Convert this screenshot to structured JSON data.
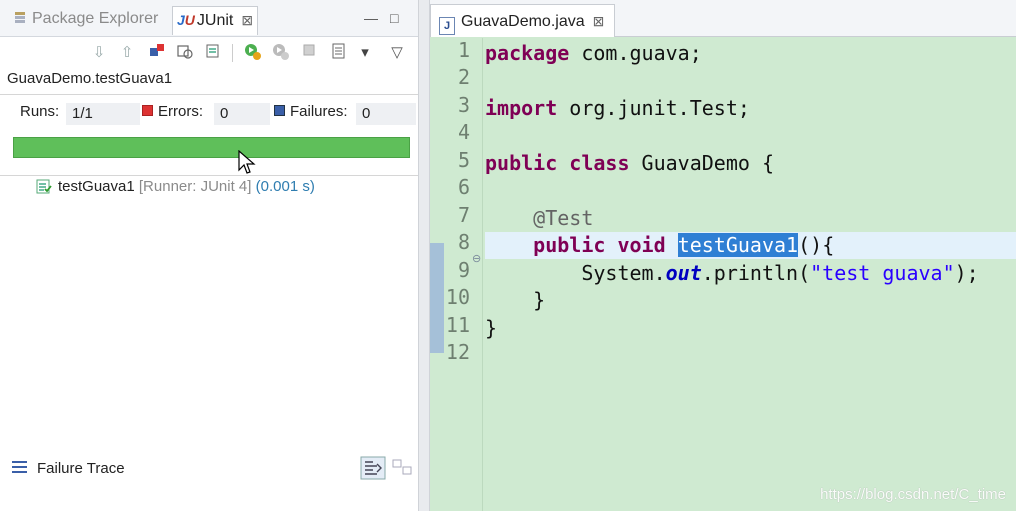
{
  "left_tabs": {
    "package_explorer": "Package Explorer",
    "junit": "JUnit",
    "junit_close": "⊠",
    "minimize": "—",
    "maximize": "□"
  },
  "junit": {
    "test_label": "GuavaDemo.testGuava1",
    "runs_label": "Runs:",
    "runs_value": "1/1",
    "errors_label": "Errors:",
    "errors_value": "0",
    "failures_label": "Failures:",
    "failures_value": "0",
    "progress": 1.0,
    "progress_color": "#5fbf5a",
    "tree": {
      "name": "testGuava1",
      "runner": "[Runner: JUnit 4]",
      "time": "(0.001 s)"
    },
    "failure_trace_label": "Failure Trace"
  },
  "editor": {
    "tab_label": "GuavaDemo.java",
    "tab_close": "⊠",
    "background": "#cfead1",
    "line_numbers": [
      "1",
      "2",
      "3",
      "4",
      "5",
      "6",
      "7",
      "8",
      "9",
      "10",
      "11",
      "12"
    ],
    "code": {
      "l1_kw": "package",
      "l1_rest": " com.guava;",
      "l3_kw": "import",
      "l3_rest": " org.junit.Test;",
      "l5_kw1": "public",
      "l5_kw2": "class",
      "l5_rest": " GuavaDemo {",
      "l7_ann": "@Test",
      "l8_kw1": "public",
      "l8_kw2": "void",
      "l8_sel": "testGuava1",
      "l8_rest": "(){",
      "l9_a": "System.",
      "l9_static": "out",
      "l9_b": ".println(",
      "l9_str": "\"test guava\"",
      "l9_c": ");",
      "l10": "}",
      "l11": "}"
    }
  },
  "watermark": "https://blog.csdn.net/C_time"
}
